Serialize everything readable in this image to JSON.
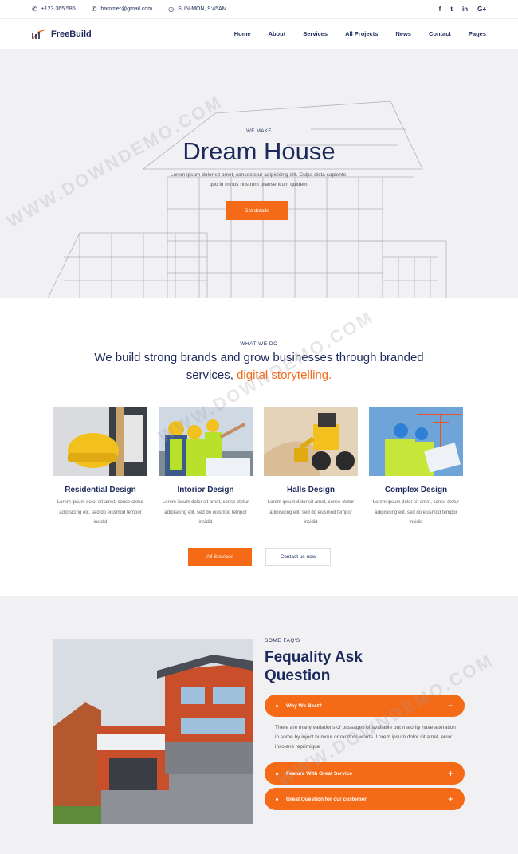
{
  "topbar": {
    "phone": "+123 365 585",
    "email": "hammer@gmail.com",
    "hours": "SUN-MON, 9:45AM",
    "social": [
      "f",
      "t",
      "in",
      "G+"
    ]
  },
  "nav": {
    "brand": "FreeBuild",
    "items": [
      "Home",
      "About",
      "Services",
      "All Projects",
      "News",
      "Contact",
      "Pages"
    ]
  },
  "hero": {
    "eyebrow": "WE MAKE",
    "title": "Dream House",
    "description": "Lorem ipsum dolor sit amet, consectetur adipisicing elit. Culpa dicta sapiente, quo in minus nostrum praesentium quidem.",
    "cta": "Get details"
  },
  "services": {
    "eyebrow": "WHAT WE DO",
    "headline_main": "We build strong brands and grow businesses through branded services,",
    "headline_accent": "digital storytelling.",
    "cards": [
      {
        "title": "Residential Design",
        "text": "Lorem ipsum dolor sit amet, conse ctetur adipisicing elit, sed do eiusmod tempor incidid"
      },
      {
        "title": "Intorior Design",
        "text": "Lorem ipsum dolor sit amet, conse ctetur adipisicing elit, sed do eiusmod tempor incidid"
      },
      {
        "title": "Halls Design",
        "text": "Lorem ipsum dolor sit amet, conse ctetur adipisicing elit, sed do eiusmod tempor incidid"
      },
      {
        "title": "Complex Design",
        "text": "Lorem ipsum dolor sit amet, conse ctetur adipisicing elit, sed do eiusmod tempor incidid"
      }
    ],
    "btn_all": "All Services",
    "btn_contact": "Contact us now"
  },
  "faq": {
    "eyebrow": "SOME FAQ'S",
    "title": "Fequality Ask Question",
    "items": [
      {
        "q": "Why We Best?",
        "toggle": "−",
        "open": true,
        "answer": "There are many variations of passages of available but majority have alteration in some by inject humour or random words. Lorem ipsum dolor sit amet, error insolens reprimique"
      },
      {
        "q": "Feature With Great Service",
        "toggle": "+",
        "open": false
      },
      {
        "q": "Great Question for our customer",
        "toggle": "+",
        "open": false
      }
    ]
  },
  "watermark": "WWW.DOWNDEMO.COM",
  "colors": {
    "primary": "#1b2a5b",
    "accent": "#f56a16",
    "bg_light": "#f1f1f3"
  }
}
